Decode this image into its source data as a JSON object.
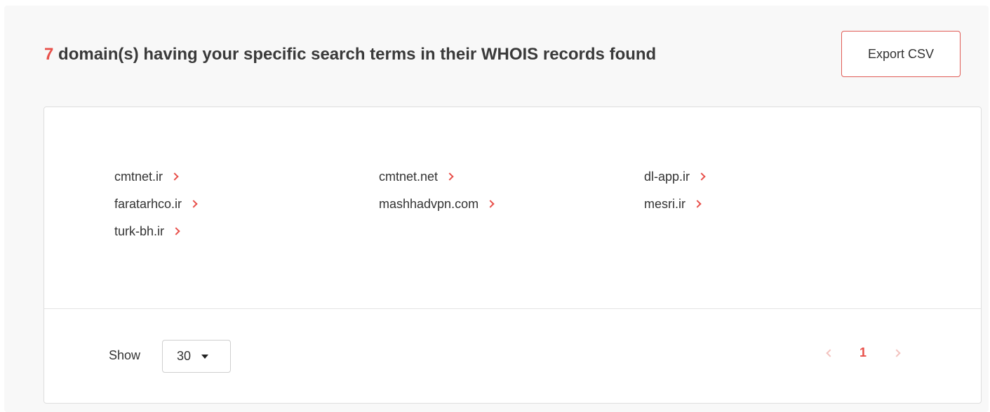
{
  "header": {
    "count": "7",
    "title_rest": " domain(s) having your specific search terms in their WHOIS records found",
    "export_label": "Export CSV"
  },
  "domains": [
    "cmtnet.ir",
    "cmtnet.net",
    "dl-app.ir",
    "faratarhco.ir",
    "mashhadvpn.com",
    "mesri.ir",
    "turk-bh.ir"
  ],
  "footer": {
    "show_label": "Show",
    "page_size": "30",
    "current_page": "1"
  },
  "colors": {
    "accent": "#e8504a",
    "accent_faded": "#f3c2bf",
    "border": "#dedede"
  },
  "icons": {
    "domain_arrow": "chevron-right-icon",
    "select_caret": "caret-down-icon",
    "prev": "chevron-left-icon",
    "next": "chevron-right-icon"
  }
}
